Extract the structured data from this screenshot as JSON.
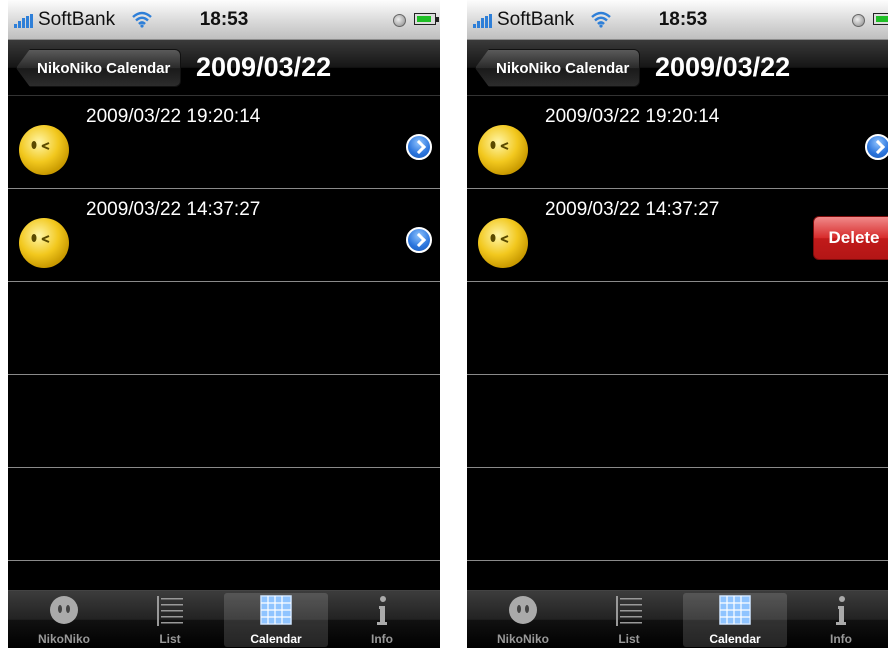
{
  "screens": [
    {
      "status": {
        "carrier": "SoftBank",
        "time": "18:53"
      },
      "nav": {
        "back_label": "NikoNiko Calendar",
        "title": "2009/03/22"
      },
      "rows": [
        {
          "timestamp": "2009/03/22 19:20:14",
          "accessory": "disclosure-icon"
        },
        {
          "timestamp": "2009/03/22 14:37:27",
          "accessory": "disclosure-icon"
        }
      ]
    },
    {
      "status": {
        "carrier": "SoftBank",
        "time": "18:53"
      },
      "nav": {
        "back_label": "NikoNiko Calendar",
        "title": "2009/03/22"
      },
      "rows": [
        {
          "timestamp": "2009/03/22 19:20:14",
          "accessory": "disclosure-icon"
        },
        {
          "timestamp": "2009/03/22 14:37:27",
          "accessory": "delete-button",
          "delete_label": "Delete"
        }
      ]
    }
  ],
  "tabs": [
    {
      "label": "NikoNiko",
      "icon": "face-icon"
    },
    {
      "label": "List",
      "icon": "list-icon"
    },
    {
      "label": "Calendar",
      "icon": "calendar-icon"
    },
    {
      "label": "Info",
      "icon": "info-icon"
    }
  ],
  "selected_tab": "Calendar",
  "colors": {
    "accent_blue": "#2a74dc",
    "delete_red": "#c11a1a",
    "face_yellow": "#f2c81e"
  }
}
